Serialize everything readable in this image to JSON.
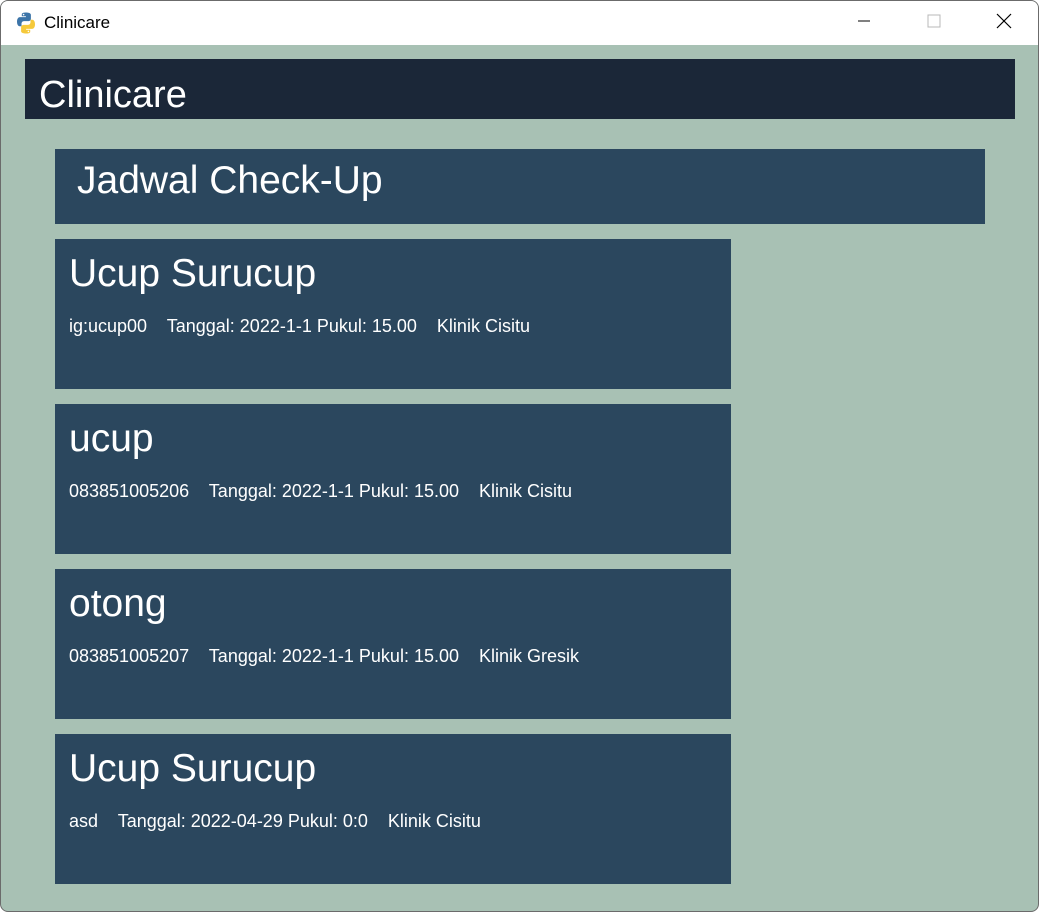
{
  "window": {
    "title": "Clinicare",
    "icon": "python-icon",
    "controls": [
      "minimize-icon",
      "maximize-icon",
      "close-icon"
    ]
  },
  "header": {
    "title": "Clinicare"
  },
  "section": {
    "title": "Jadwal Check-Up"
  },
  "appointments": [
    {
      "name": "Ucup Surucup",
      "info": "ig:ucup00    Tanggal: 2022-1-1 Pukul: 15.00    Klinik Cisitu"
    },
    {
      "name": "ucup",
      "info": "083851005206    Tanggal: 2022-1-1 Pukul: 15.00    Klinik Cisitu"
    },
    {
      "name": "otong",
      "info": "083851005207    Tanggal: 2022-1-1 Pukul: 15.00    Klinik Gresik"
    },
    {
      "name": "Ucup Surucup",
      "info": "asd    Tanggal: 2022-04-29 Pukul: 0:0    Klinik Cisitu"
    }
  ],
  "colors": {
    "background": "#a8c1b4",
    "header": "#1b2738",
    "card": "#2b475e",
    "text": "#ffffff"
  }
}
